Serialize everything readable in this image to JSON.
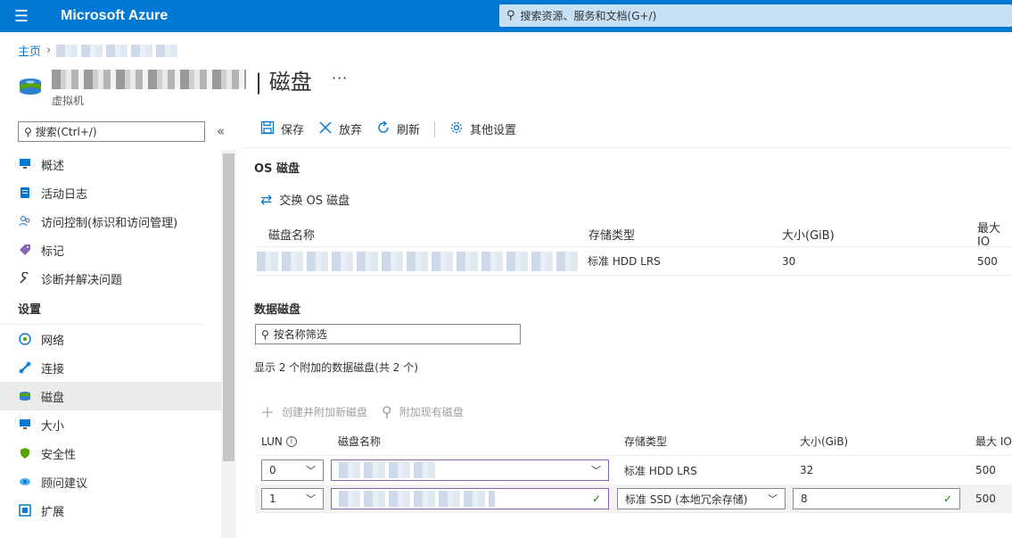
{
  "topbar": {
    "brand": "Microsoft Azure",
    "search_placeholder": "搜索资源、服务和文档(G+/)"
  },
  "breadcrumb": {
    "home": "主页"
  },
  "resource": {
    "subtitle": "虚拟机",
    "page_title": "| 磁盘",
    "more": "···"
  },
  "sidebar": {
    "search": "搜索(Ctrl+/)",
    "collapse": "«",
    "items_top": [
      {
        "label": "概述",
        "icon": "monitor-icon"
      },
      {
        "label": "活动日志",
        "icon": "log-icon"
      },
      {
        "label": "访问控制(标识和访问管理)",
        "icon": "people-icon"
      },
      {
        "label": "标记",
        "icon": "tag-icon"
      },
      {
        "label": "诊断并解决问题",
        "icon": "wrench-icon"
      }
    ],
    "section_settings": "设置",
    "items_settings": [
      {
        "label": "网络",
        "icon": "network-icon"
      },
      {
        "label": "连接",
        "icon": "connect-icon"
      },
      {
        "label": "磁盘",
        "icon": "disk-icon",
        "active": true
      },
      {
        "label": "大小",
        "icon": "size-icon"
      },
      {
        "label": "安全性",
        "icon": "shield-icon"
      },
      {
        "label": "顾问建议",
        "icon": "advisor-icon"
      },
      {
        "label": "扩展",
        "icon": "extension-icon"
      }
    ]
  },
  "toolbar": {
    "save": "保存",
    "discard": "放弃",
    "refresh": "刷新",
    "other_settings": "其他设置"
  },
  "os_disk": {
    "title": "OS 磁盘",
    "swap": "交换 OS 磁盘",
    "headers": {
      "name": "磁盘名称",
      "storage": "存储类型",
      "size": "大小(GiB)",
      "iops": "最大 IO"
    },
    "row": {
      "storage": "标准 HDD LRS",
      "size": "30",
      "iops": "500"
    }
  },
  "data_disks": {
    "title": "数据磁盘",
    "filter_placeholder": "按名称筛选",
    "count_text": "显示 2 个附加的数据磁盘(共 2 个)",
    "create_attach": "创建并附加新磁盘",
    "attach_existing": "附加现有磁盘",
    "headers": {
      "lun": "LUN",
      "name": "磁盘名称",
      "storage": "存储类型",
      "size": "大小(GiB)",
      "iops": "最大 IO"
    },
    "rows": [
      {
        "lun": "0",
        "storage": "标准 HDD LRS",
        "size": "32",
        "iops": "500"
      },
      {
        "lun": "1",
        "storage": "标准 SSD (本地冗余存储)",
        "size": "8",
        "iops": "500"
      }
    ]
  },
  "colors": {
    "accent": "#0078d4",
    "topbar": "#0078d4",
    "search_bg": "#c7e0f4",
    "success": "#107c10"
  }
}
